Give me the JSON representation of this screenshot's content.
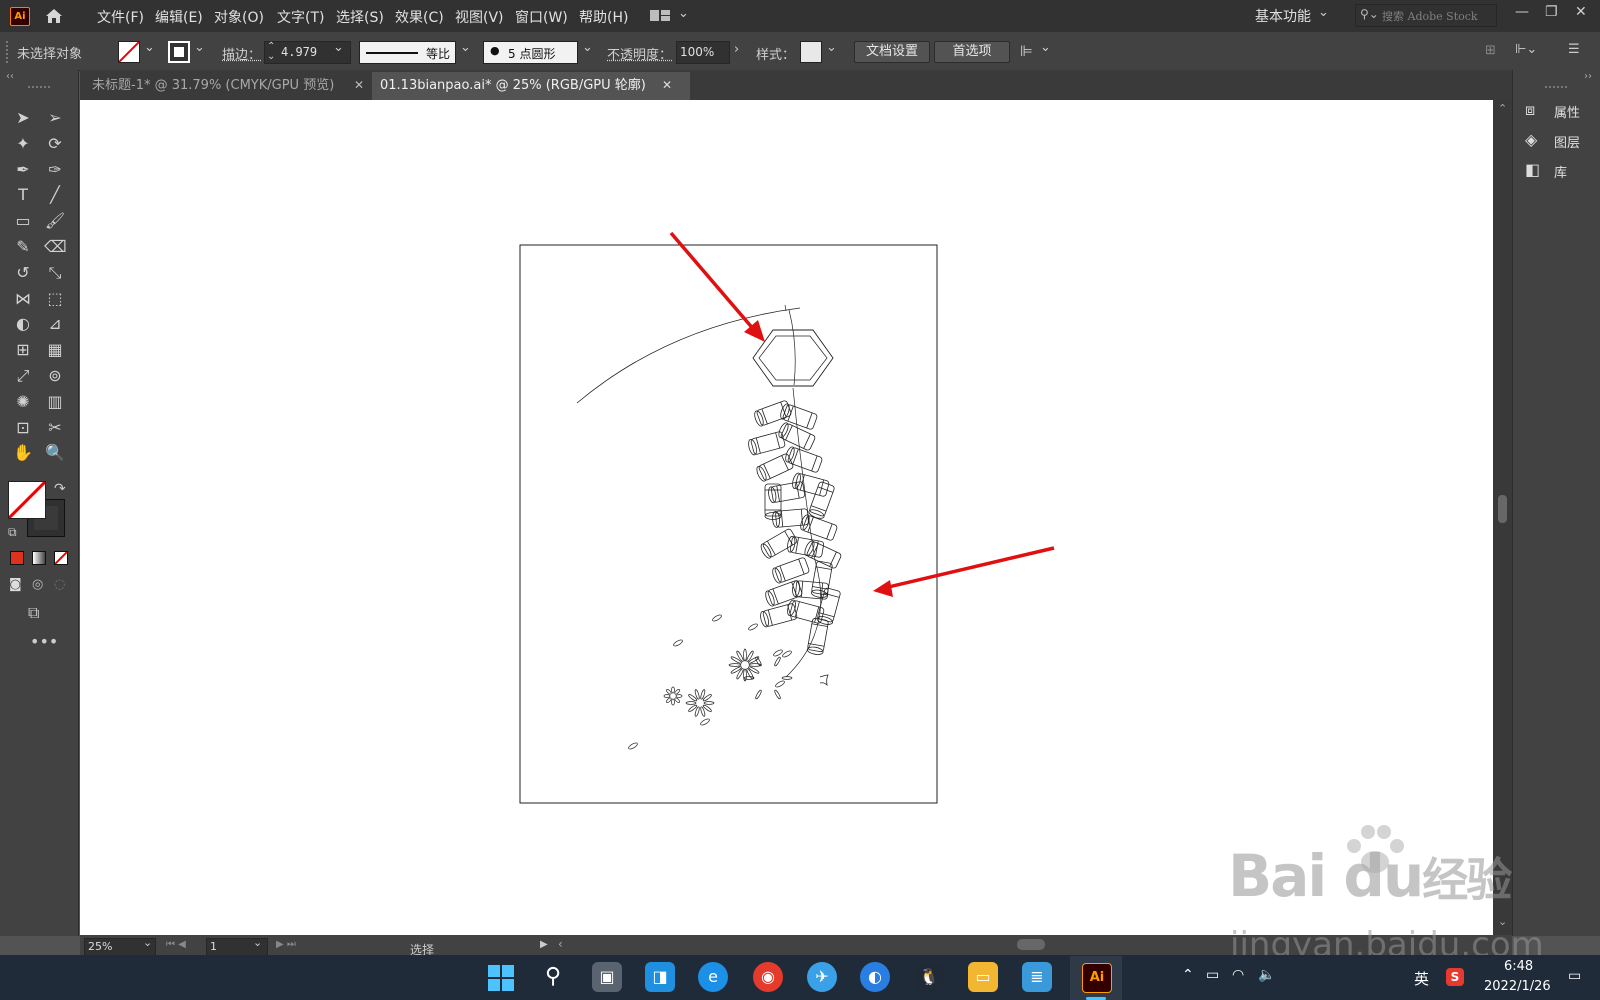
{
  "app": {
    "logo": "Ai"
  },
  "menus": [
    "文件(F)",
    "编辑(E)",
    "对象(O)",
    "文字(T)",
    "选择(S)",
    "效果(C)",
    "视图(V)",
    "窗口(W)",
    "帮助(H)"
  ],
  "workspace": {
    "label": "基本功能",
    "search_placeholder": "搜索 Adobe Stock"
  },
  "control": {
    "selection_label": "未选择对象",
    "stroke_label": "描边：",
    "stroke_value": "4.979",
    "profile_label": "等比",
    "brush_label": "5 点圆形",
    "opacity_label": "不透明度：",
    "opacity_value": "100%",
    "style_label": "样式：",
    "doc_setup": "文档设置",
    "prefs": "首选项"
  },
  "tabs": [
    {
      "title": "未标题-1* @ 31.79% (CMYK/GPU 预览)",
      "active": false
    },
    {
      "title": "01.13bianpao.ai* @ 25% (RGB/GPU 轮廓)",
      "active": true
    }
  ],
  "panels": [
    {
      "label": "属性",
      "icon": "properties-icon"
    },
    {
      "label": "图层",
      "icon": "layers-icon"
    },
    {
      "label": "库",
      "icon": "libraries-icon"
    }
  ],
  "status": {
    "zoom": "25%",
    "page": "1",
    "mode": "选择"
  },
  "taskbar": {
    "ime": "英",
    "time": "6:48",
    "date": "2022/1/26"
  },
  "watermark": {
    "brand": "Bai du",
    "cn": "经验",
    "url": "jingyan.baidu.com"
  },
  "colors": {
    "accent_red": "#e01010",
    "ai_orange": "#ff9a00",
    "canvas": "#ffffff"
  }
}
